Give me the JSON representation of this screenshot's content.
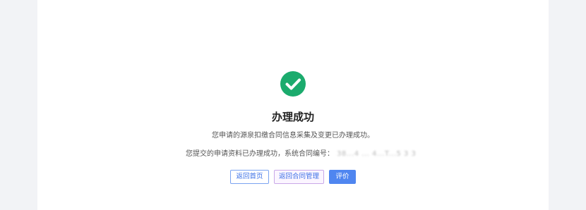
{
  "result": {
    "status_icon": "check-circle-icon",
    "status_color": "#1bab6d",
    "title": "办理成功",
    "subtitle": "您申请的源泉扣缴合同信息采集及变更已办理成功。",
    "detail_prefix": "您提交的申请资料已办理成功，系统合同编号：",
    "contract_number": "38...4 ... 4...T...5 3 3"
  },
  "actions": {
    "home_label": "返回首页",
    "contract_manage_label": "返回合同管理",
    "rate_label": "评价"
  },
  "colors": {
    "accent": "#4f86f0",
    "page_background": "#f2f3f6",
    "card_background": "#ffffff"
  }
}
